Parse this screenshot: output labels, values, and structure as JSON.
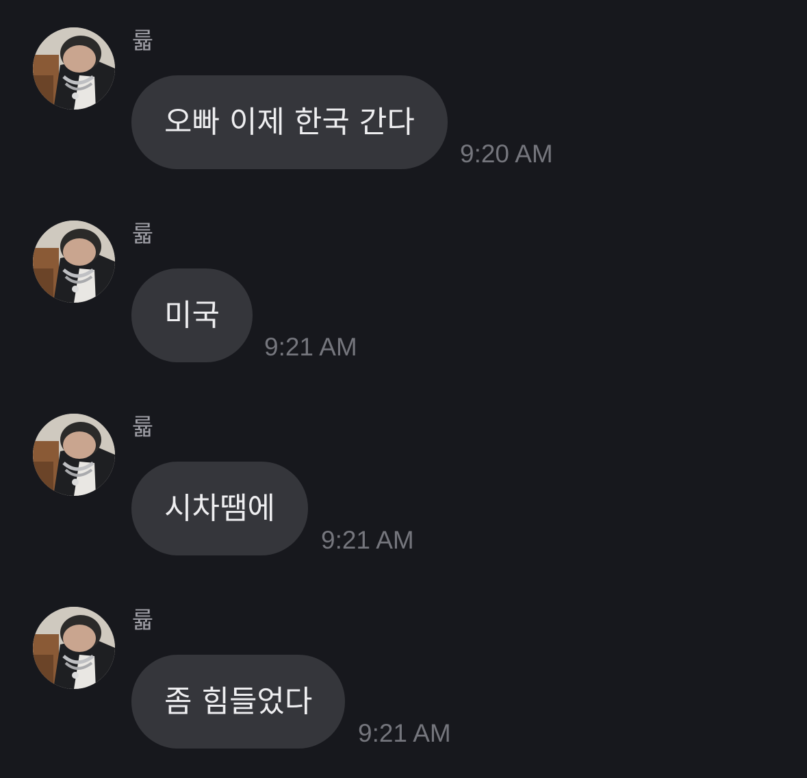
{
  "messages": [
    {
      "sender": "륣",
      "text": "오빠 이제 한국 간다",
      "time": "9:20 AM"
    },
    {
      "sender": "륣",
      "text": "미국",
      "time": "9:21 AM"
    },
    {
      "sender": "륣",
      "text": "시차땜에",
      "time": "9:21 AM"
    },
    {
      "sender": "륣",
      "text": "좀 힘들었다",
      "time": "9:21 AM"
    }
  ],
  "colors": {
    "background": "#17181d",
    "bubble": "#35363b",
    "bubble_text": "#eeeef0",
    "sender_text": "#9c9ca3",
    "time_text": "#75767d"
  },
  "icons": {
    "avatar": "profile-photo"
  }
}
